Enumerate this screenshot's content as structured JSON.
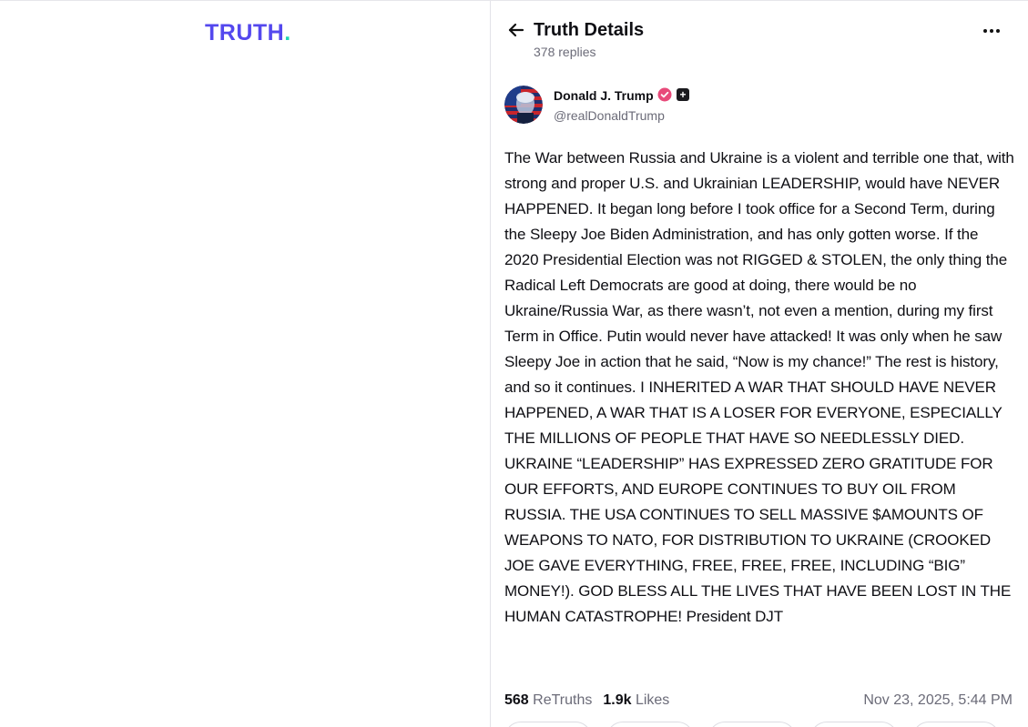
{
  "brand": {
    "logo_text": "TRUTH",
    "logo_dot": ".",
    "logo_color": "#5448ee",
    "dot_color": "#1fd5b2"
  },
  "header": {
    "title": "Truth Details",
    "subtitle": "378 replies",
    "back_icon": "arrow-left-icon",
    "more_icon": "ellipsis-icon"
  },
  "post": {
    "author": {
      "name": "Donald J. Trump",
      "handle": "@realDonaldTrump",
      "verified_color": "#e84a7a",
      "plus_badge": "+"
    },
    "body": "The War between Russia and Ukraine is a violent and terrible one that, with strong and proper U.S. and Ukrainian LEADERSHIP, would have NEVER HAPPENED. It began long before I took office for a Second Term, during the Sleepy Joe Biden Administration, and has only gotten worse. If the 2020 Presidential Election was not RIGGED & STOLEN, the only thing the Radical Left Democrats are good at doing, there would be no Ukraine/Russia War, as there wasn’t, not even a mention, during my first Term in Office. Putin would never have attacked! It was only when he saw Sleepy Joe in action that he said, “Now is my chance!” The rest is history, and so it continues. I INHERITED A WAR THAT SHOULD HAVE NEVER HAPPENED, A WAR THAT IS A LOSER FOR EVERYONE, ESPECIALLY THE MILLIONS OF PEOPLE THAT HAVE SO NEEDLESSLY DIED. UKRAINE “LEADERSHIP” HAS EXPRESSED ZERO GRATITUDE FOR OUR EFFORTS, AND EUROPE CONTINUES TO BUY OIL FROM RUSSIA. THE USA CONTINUES TO SELL MASSIVE $AMOUNTS OF WEAPONS TO NATO, FOR DISTRIBUTION TO UKRAINE (CROOKED JOE GAVE EVERYTHING, FREE, FREE, FREE, INCLUDING “BIG” MONEY!). GOD BLESS ALL THE LIVES THAT HAVE BEEN LOST IN THE HUMAN CATASTROPHE! President DJT",
    "stats": {
      "retruths_count": "568",
      "retruths_label": "ReTruths",
      "likes_count": "1.9k",
      "likes_label": "Likes"
    },
    "timestamp": "Nov 23, 2025, 5:44 PM"
  }
}
